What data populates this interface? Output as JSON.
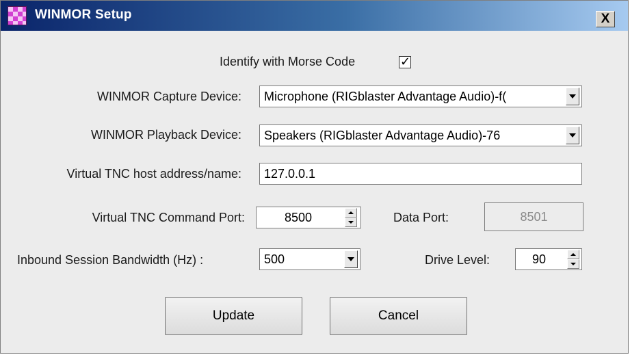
{
  "window": {
    "title": "WINMOR Setup",
    "close_label": "X"
  },
  "morse": {
    "label": "Identify with Morse Code",
    "checked": true,
    "check_glyph": "✓"
  },
  "capture": {
    "label": "WINMOR Capture Device:",
    "value": "Microphone (RIGblaster Advantage Audio)-f("
  },
  "playback": {
    "label": "WINMOR Playback Device:",
    "value": "Speakers (RIGblaster Advantage Audio)-76"
  },
  "host": {
    "label": "Virtual TNC host address/name:",
    "value": "127.0.0.1"
  },
  "command_port": {
    "label": "Virtual TNC Command Port:",
    "value": "8500"
  },
  "data_port": {
    "label": "Data Port:",
    "value": "8501"
  },
  "bandwidth": {
    "label": "Inbound Session Bandwidth (Hz) :",
    "value": "500"
  },
  "drive_level": {
    "label": "Drive Level:",
    "value": "90"
  },
  "buttons": {
    "update": "Update",
    "cancel": "Cancel"
  },
  "colors": {
    "title_bar_start": "#0a246a",
    "title_bar_end": "#a6caf0",
    "dialog_bg": "#ececec"
  }
}
